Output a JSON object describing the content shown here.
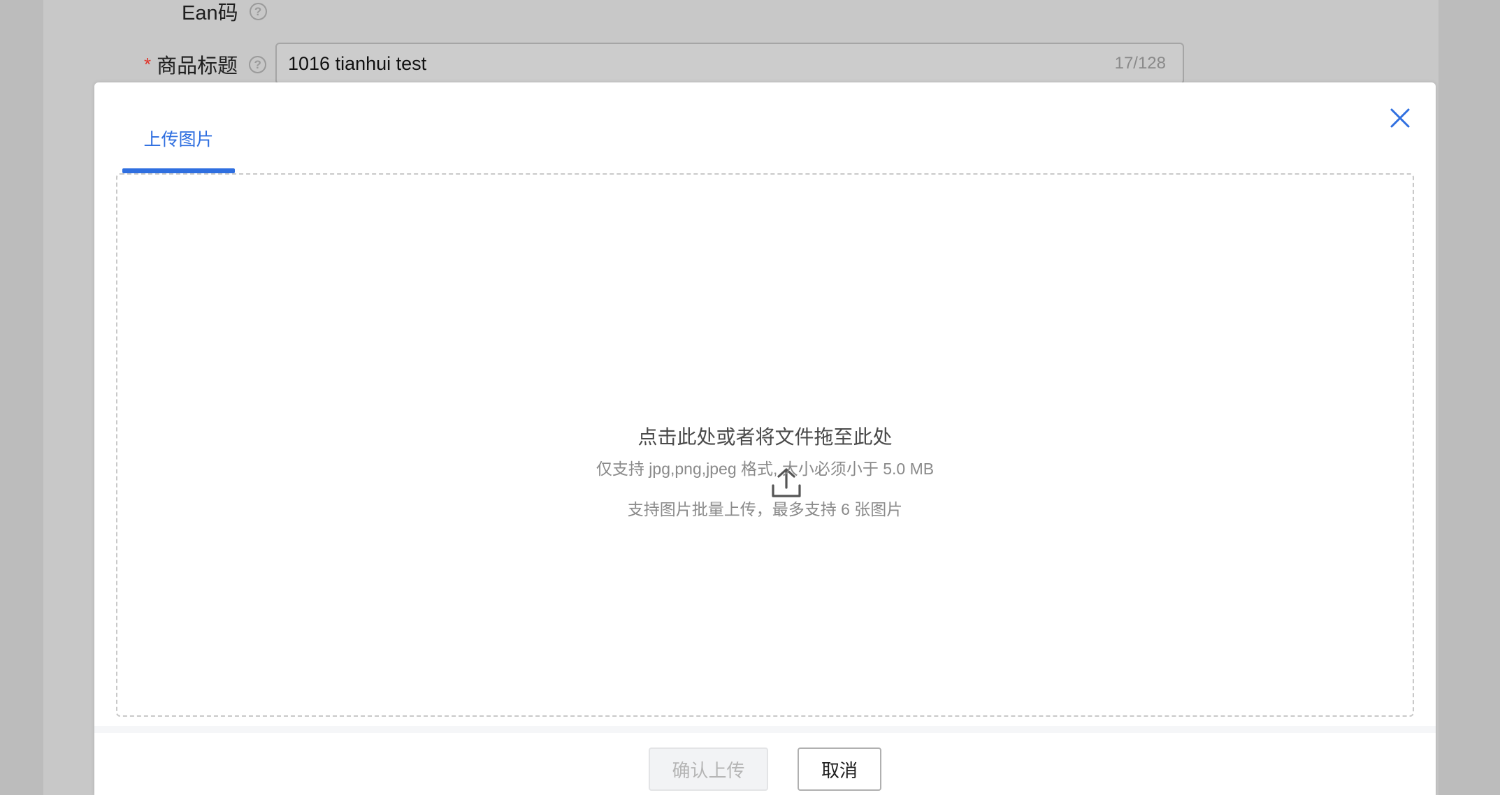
{
  "form": {
    "ean_label": "Ean码",
    "title_required_mark": "*",
    "title_label": "商品标题",
    "title_value": "1016 tianhui test",
    "title_counter": "17/128",
    "help_glyph": "?"
  },
  "modal": {
    "tab_label": "上传图片",
    "dropzone": {
      "icon": "upload-icon",
      "title": "点击此处或者将文件拖至此处",
      "hint_format": "仅支持 jpg,png,jpeg 格式, 大小必须小于 5.0 MB",
      "hint_batch": "支持图片批量上传，最多支持 6 张图片"
    },
    "confirm_label": "确认上传",
    "cancel_label": "取消"
  },
  "colors": {
    "accent": "#2f6fe0",
    "required": "#e0352b",
    "overlay": "#c8c8c8"
  }
}
